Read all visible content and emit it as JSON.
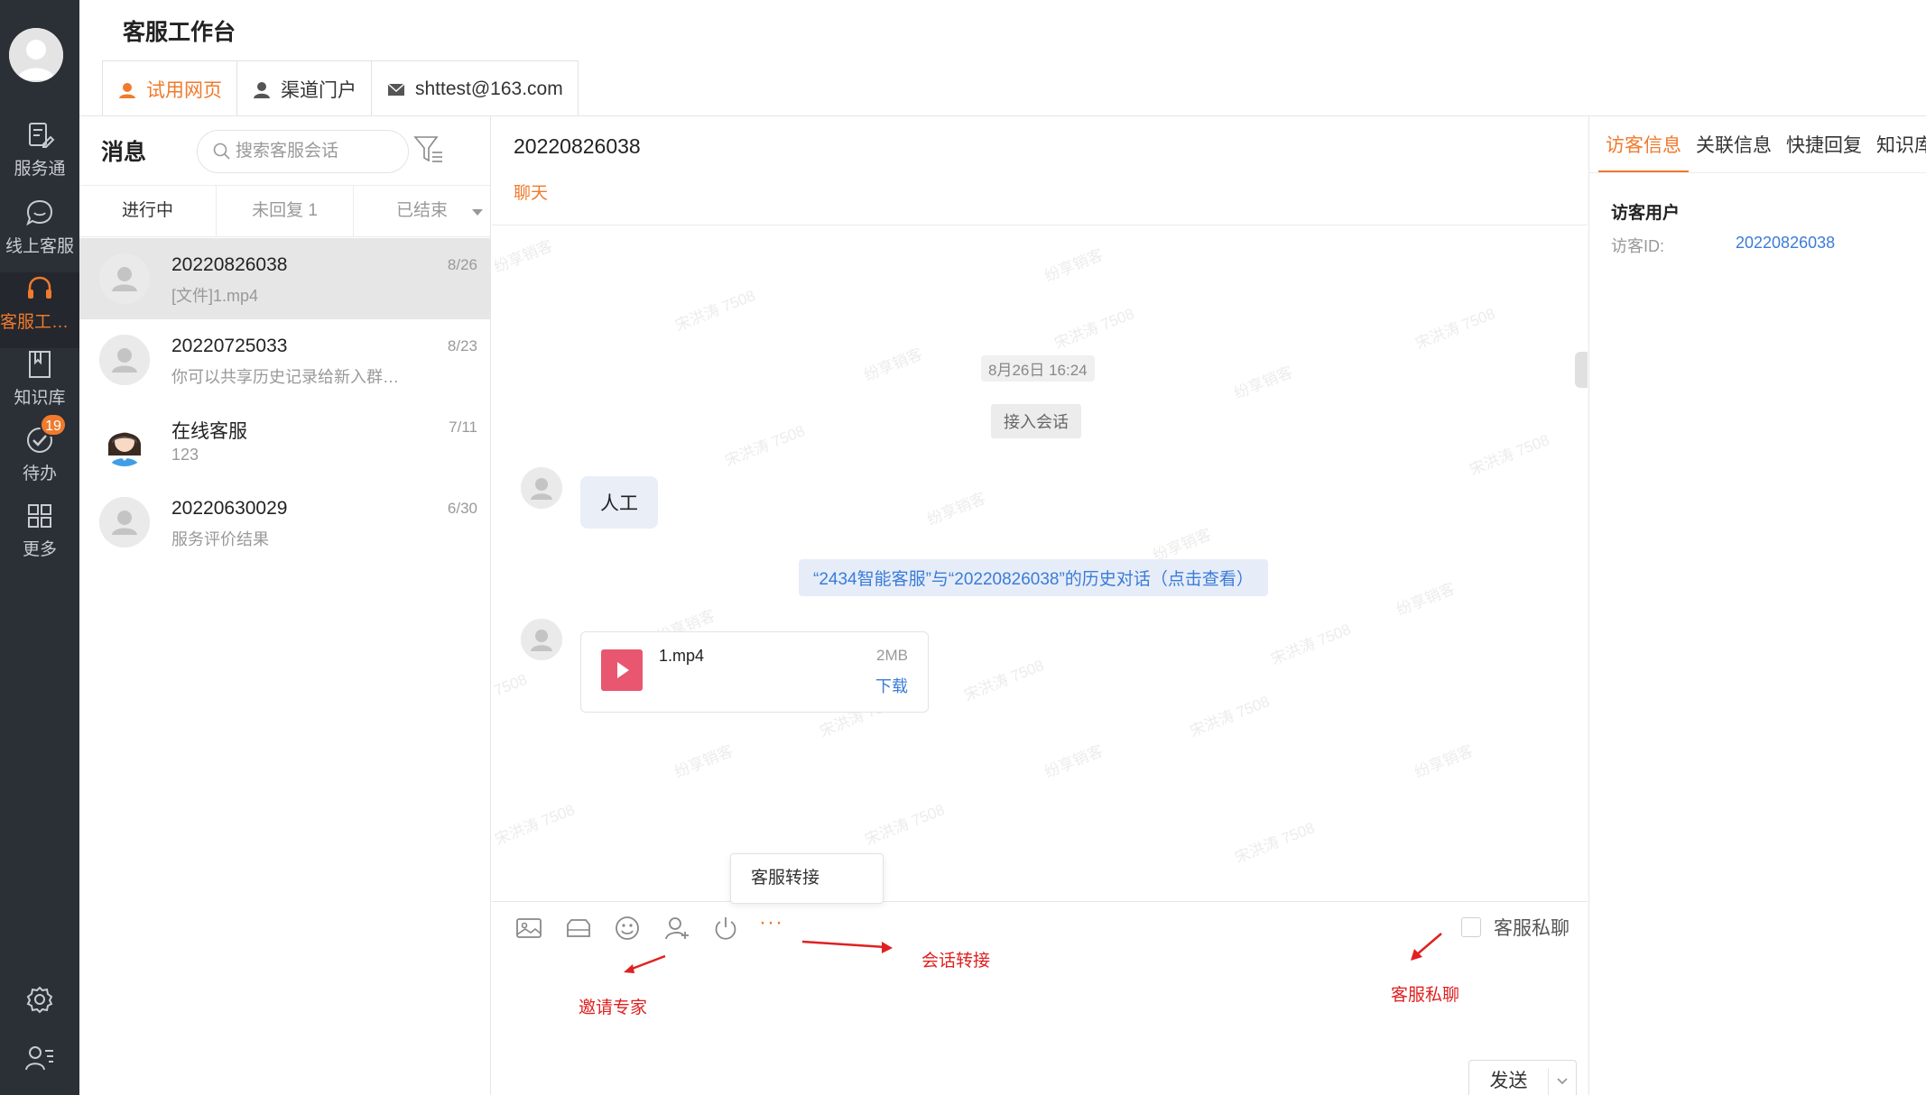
{
  "app": {
    "title": "客服工作台"
  },
  "top_tabs": [
    {
      "label": "试用网页",
      "icon": "headset-icon",
      "active": true
    },
    {
      "label": "渠道门户",
      "icon": "user-icon",
      "active": false
    },
    {
      "label": "shttest@163.com",
      "icon": "mail-icon",
      "active": false
    }
  ],
  "rail": {
    "items": [
      {
        "label": "服务通",
        "icon": "ticket-edit-icon"
      },
      {
        "label": "线上客服",
        "icon": "chat-bubble-icon"
      },
      {
        "label": "客服工作台",
        "icon": "headset-icon",
        "active": true
      },
      {
        "label": "知识库",
        "icon": "book-icon"
      },
      {
        "label": "待办",
        "icon": "check-circle-icon",
        "badge": "19"
      },
      {
        "label": "更多",
        "icon": "grid-icon"
      }
    ],
    "bottom": [
      "gear-icon",
      "user-list-icon"
    ]
  },
  "list": {
    "title": "消息",
    "search_placeholder": "搜索客服会话",
    "tabs": [
      {
        "label": "进行中",
        "active": true
      },
      {
        "label": "未回复 1",
        "active": false
      },
      {
        "label": "已结束",
        "active": false
      }
    ],
    "conversations": [
      {
        "name": "20220826038",
        "snippet": "[文件]1.mp4",
        "date": "8/26",
        "active": true
      },
      {
        "name": "20220725033",
        "snippet": "你可以共享历史记录给新入群…",
        "date": "8/23",
        "active": false
      },
      {
        "name": "在线客服",
        "snippet": "123",
        "date": "7/11",
        "active": false
      },
      {
        "name": "20220630029",
        "snippet": "服务评价结果",
        "date": "6/30",
        "active": false
      }
    ]
  },
  "chat": {
    "visitor_id": "20220826038",
    "subtab": "聊天",
    "time": "8月26日 16:24",
    "system_msg": "接入会话",
    "visitor_msg": "人工",
    "history_link": "“2434智能客服”与“20220826038”的历史对话（点击查看）",
    "file": {
      "name": "1.mp4",
      "size": "2MB",
      "download": "下载"
    },
    "watermarks": [
      "宋洪涛 7508",
      "纷享销客",
      "7508"
    ],
    "popup_item": "客服转接",
    "more_label": "···",
    "private_chat": "客服私聊",
    "send": "发送"
  },
  "annotations": {
    "invite_expert": "邀请专家",
    "session_transfer": "会话转接",
    "private_chat": "客服私聊",
    "color": "#e02020"
  },
  "info": {
    "tabs": [
      {
        "label": "访客信息",
        "active": true
      },
      {
        "label": "关联信息",
        "active": false
      },
      {
        "label": "快捷回复",
        "active": false
      },
      {
        "label": "知识库",
        "active": false
      }
    ],
    "section": "访客用户",
    "id_label": "访客ID:",
    "id_value": "20220826038"
  },
  "colors": {
    "accent": "#f07a2d",
    "link": "#3b7bd8",
    "rail_bg": "#2b2f36"
  }
}
